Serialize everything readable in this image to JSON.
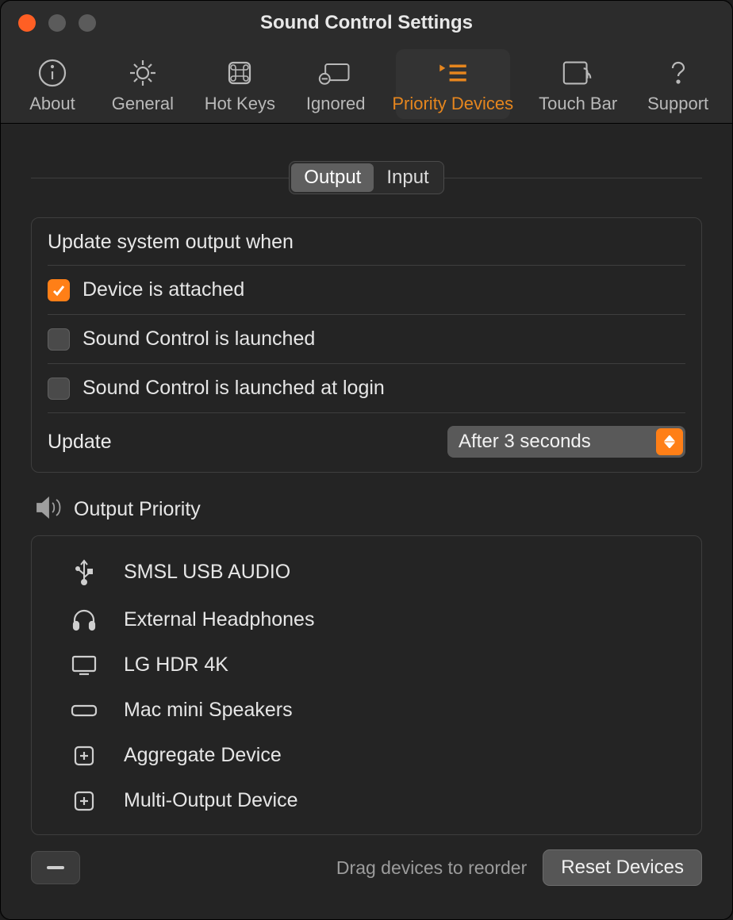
{
  "window": {
    "title": "Sound Control Settings"
  },
  "toolbar": [
    {
      "id": "about",
      "label": "About"
    },
    {
      "id": "general",
      "label": "General"
    },
    {
      "id": "hotkeys",
      "label": "Hot Keys"
    },
    {
      "id": "ignored",
      "label": "Ignored"
    },
    {
      "id": "priority",
      "label": "Priority Devices",
      "selected": true
    },
    {
      "id": "touchbar",
      "label": "Touch Bar"
    },
    {
      "id": "support",
      "label": "Support"
    }
  ],
  "segmented": {
    "output": "Output",
    "input": "Input",
    "selected": "output"
  },
  "updateSection": {
    "heading": "Update system output when",
    "checks": [
      {
        "label": "Device is attached",
        "checked": true
      },
      {
        "label": "Sound Control is launched",
        "checked": false
      },
      {
        "label": "Sound Control is launched at login",
        "checked": false
      }
    ],
    "updateLabel": "Update",
    "updateValue": "After 3 seconds"
  },
  "outputPriority": {
    "title": "Output Priority",
    "devices": [
      {
        "icon": "usb",
        "name": "SMSL USB AUDIO"
      },
      {
        "icon": "headphones",
        "name": "External Headphones"
      },
      {
        "icon": "display",
        "name": "LG HDR 4K"
      },
      {
        "icon": "macmini",
        "name": "Mac mini Speakers"
      },
      {
        "icon": "plusbox",
        "name": "Aggregate Device"
      },
      {
        "icon": "plusbox",
        "name": "Multi-Output Device"
      }
    ]
  },
  "footer": {
    "hint": "Drag devices to reorder",
    "reset": "Reset Devices"
  }
}
